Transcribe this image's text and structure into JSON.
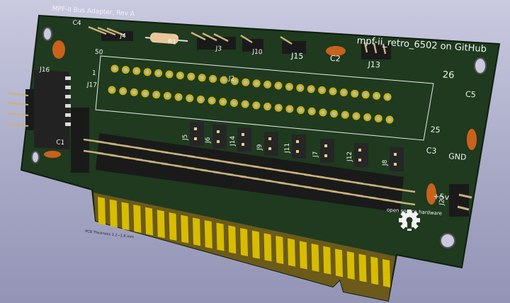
{
  "board": {
    "title": "MPF-II Bus Adapter, Rev A",
    "github": "mpf-ii_retro_6502 on GitHub",
    "thickness_note": "PCB Thickness 1.2~1.6 mm",
    "oshw_logo": "open source hardware",
    "colors": {
      "pcb": "#1e3a1e",
      "silk": "#f2f2f2",
      "gold": "#d4b800",
      "pad": "#c8b400"
    }
  },
  "refs": {
    "c4": "C4",
    "j4": "J4",
    "r1": "R1",
    "j3": "J3",
    "j10": "J10",
    "j15": "J15",
    "c2": "C2",
    "j13": "J13",
    "j2": "J2",
    "pin50": "50",
    "pin1": "1",
    "pin26": "26",
    "pin25": "25",
    "j16": "J16",
    "j17": "J17",
    "c1": "C1",
    "j5": "J5",
    "j6": "J6",
    "j14": "J14",
    "j9": "J9",
    "j11": "J11",
    "j7": "J7",
    "j12": "J12",
    "j8": "J8",
    "c5": "C5",
    "c3": "C3",
    "j27": "J27",
    "gnd": "GND",
    "vcc": "+5v"
  }
}
